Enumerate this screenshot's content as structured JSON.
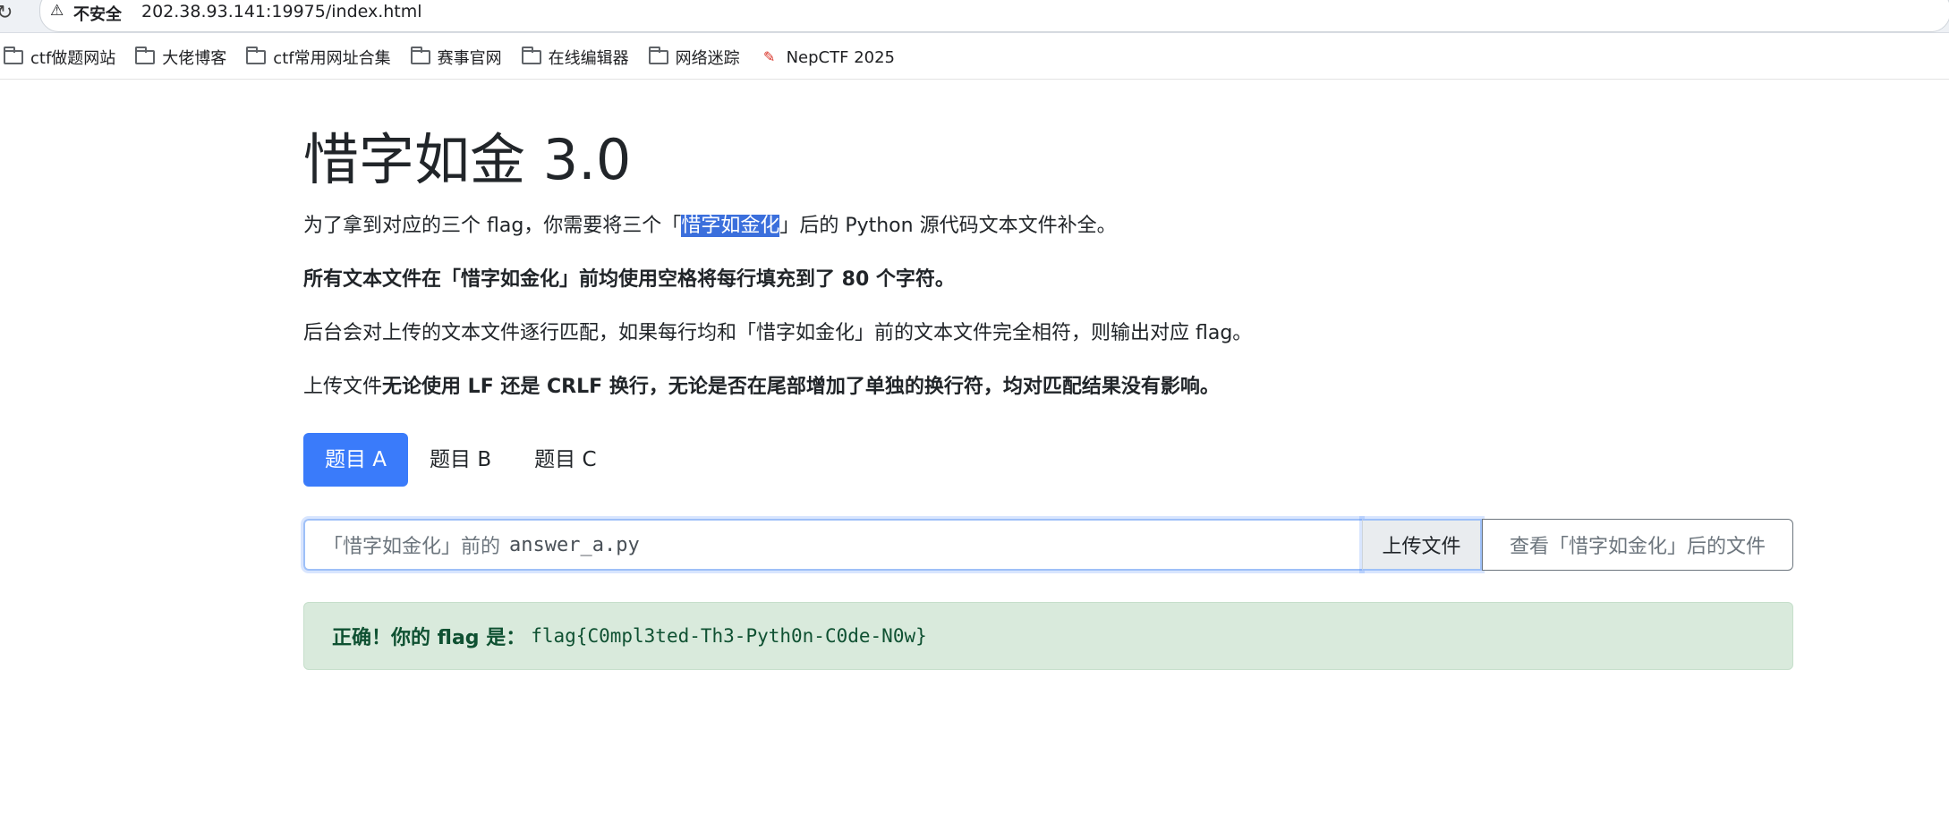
{
  "browser": {
    "security_label": "不安全",
    "url": "202.38.93.141:19975/index.html",
    "bookmarks": [
      {
        "label": "ctf做题网站",
        "icon": "folder-icon"
      },
      {
        "label": "大佬博客",
        "icon": "folder-icon"
      },
      {
        "label": "ctf常用网址合集",
        "icon": "folder-icon"
      },
      {
        "label": "赛事官网",
        "icon": "folder-icon"
      },
      {
        "label": "在线编辑器",
        "icon": "folder-icon"
      },
      {
        "label": "网络迷踪",
        "icon": "folder-icon"
      },
      {
        "label": "NepCTF 2025",
        "icon": "nepctf-favicon"
      }
    ]
  },
  "page": {
    "title": "惜字如金 3.0",
    "p1": {
      "before": "为了拿到对应的三个 flag，你需要将三个「",
      "highlight": "惜字如金化",
      "after": "」后的 Python 源代码文本文件补全。"
    },
    "p2": "所有文本文件在「惜字如金化」前均使用空格将每行填充到了 80 个字符。",
    "p3": "后台会对上传的文本文件逐行匹配，如果每行均和「惜字如金化」前的文本文件完全相符，则输出对应 flag。",
    "p4": {
      "plain": "上传文件",
      "bold": "无论使用 LF 还是 CRLF 换行，无论是否在尾部增加了单独的换行符，均对匹配结果没有影响。"
    },
    "tabs": [
      "题目 A",
      "题目 B",
      "题目 C"
    ],
    "active_tab": "题目 A",
    "file_input": {
      "prefix": "「惜字如金化」前的",
      "filename": "answer_a.py"
    },
    "upload_label": "上传文件",
    "view_label": "查看「惜字如金化」后的文件",
    "result": {
      "label": "正确！你的 flag 是：",
      "flag": "flag{C0mpl3ted-Th3-Pyth0n-C0de-N0w}"
    }
  },
  "colors": {
    "accent": "#3a7bfa",
    "success_bg": "#d9eadc",
    "success_text": "#0f5132"
  }
}
